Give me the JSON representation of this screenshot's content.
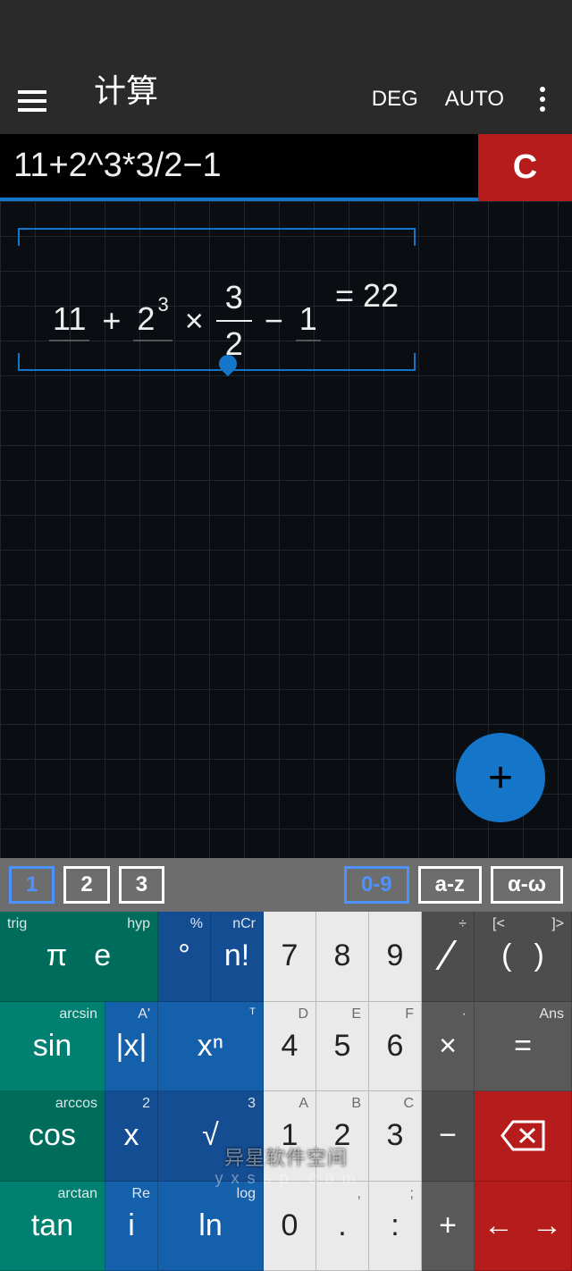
{
  "header": {
    "title": "计算",
    "mode_deg": "DEG",
    "mode_auto": "AUTO"
  },
  "input": {
    "expression": "11+2^3*3/2−1",
    "clear": "C"
  },
  "equation": {
    "t1": "11",
    "plus": "+",
    "t2": "2",
    "t2_sup": "3",
    "times": "×",
    "frac_num": "3",
    "frac_den": "2",
    "minus": "−",
    "t3": "1",
    "eq": "=",
    "result": "22"
  },
  "fab": "+",
  "tabs": {
    "t1": "1",
    "t2": "2",
    "t3": "3",
    "r1": "0-9",
    "r2": "a-z",
    "r3": "α-ω"
  },
  "keys": {
    "pi": "π",
    "pi_h": "trig",
    "e": "e",
    "e_h": "hyp",
    "deg": "°",
    "deg_h": "%",
    "fact": "n!",
    "fact_h": "nCr",
    "n7": "7",
    "n8": "8",
    "n9": "9",
    "div": "∕",
    "div_h": "÷",
    "lp": "(",
    "lp_h": "[<",
    "rp": ")",
    "rp_h": "]>",
    "sin": "sin",
    "sin_h": "arcsin",
    "abs": "|x|",
    "abs_h": "A'",
    "pow": "xⁿ",
    "pow_h": "ᵀ",
    "n4": "4",
    "n4_h": "D",
    "n5": "5",
    "n5_h": "E",
    "n6": "6",
    "n6_h": "F",
    "mul": "×",
    "mul_h": "·",
    "eqk": "=",
    "eq_h": "Ans",
    "cos": "cos",
    "cos_h": "arccos",
    "x": "x",
    "x_h": "2",
    "sqrt": "√",
    "sqrt_h": "3",
    "n1": "1",
    "n1_h": "A",
    "n2": "2",
    "n2_h": "B",
    "n3": "3",
    "n3_h": "C",
    "sub": "−",
    "tan": "tan",
    "tan_h": "arctan",
    "i": "i",
    "i_h": "Re",
    "ln": "ln",
    "ln_h": "log",
    "n0": "0",
    "dot": ".",
    "dot_h": ",",
    "colon": ":",
    "colon_h": ";",
    "add": "+",
    "left": "←",
    "right": "→"
  },
  "watermark": {
    "l1": "异星软件空间",
    "l2": "y x s s p . c o m"
  }
}
